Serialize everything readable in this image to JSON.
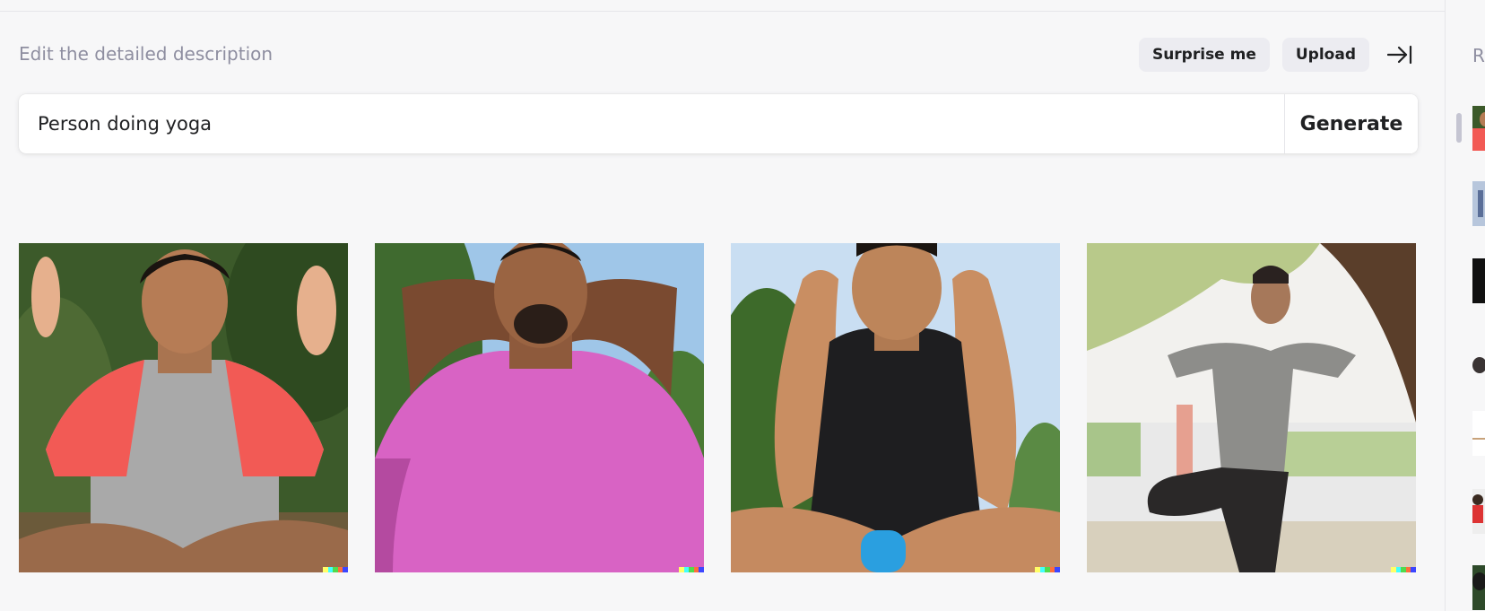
{
  "header": {
    "description_label": "Edit the detailed description",
    "surprise_label": "Surprise me",
    "upload_label": "Upload",
    "collapse_icon": "collapse-right-icon"
  },
  "prompt": {
    "value": "Person doing yoga",
    "generate_label": "Generate"
  },
  "results": [
    {
      "description": "man meditating, red and grey shirt"
    },
    {
      "description": "man stretching, pink shirt"
    },
    {
      "description": "man meditating, black tank top"
    },
    {
      "description": "man in tree pose under a tree"
    }
  ],
  "sidebar": {
    "label_partial": "R",
    "thumbnail_count": 7
  },
  "colors": {
    "background": "#f7f7f8",
    "pill_bg": "#ececf1",
    "muted_text": "#8e8ea0",
    "signature": [
      "#ffff66",
      "#42ffff",
      "#51da4c",
      "#ff6e3c",
      "#3c46ff"
    ]
  }
}
